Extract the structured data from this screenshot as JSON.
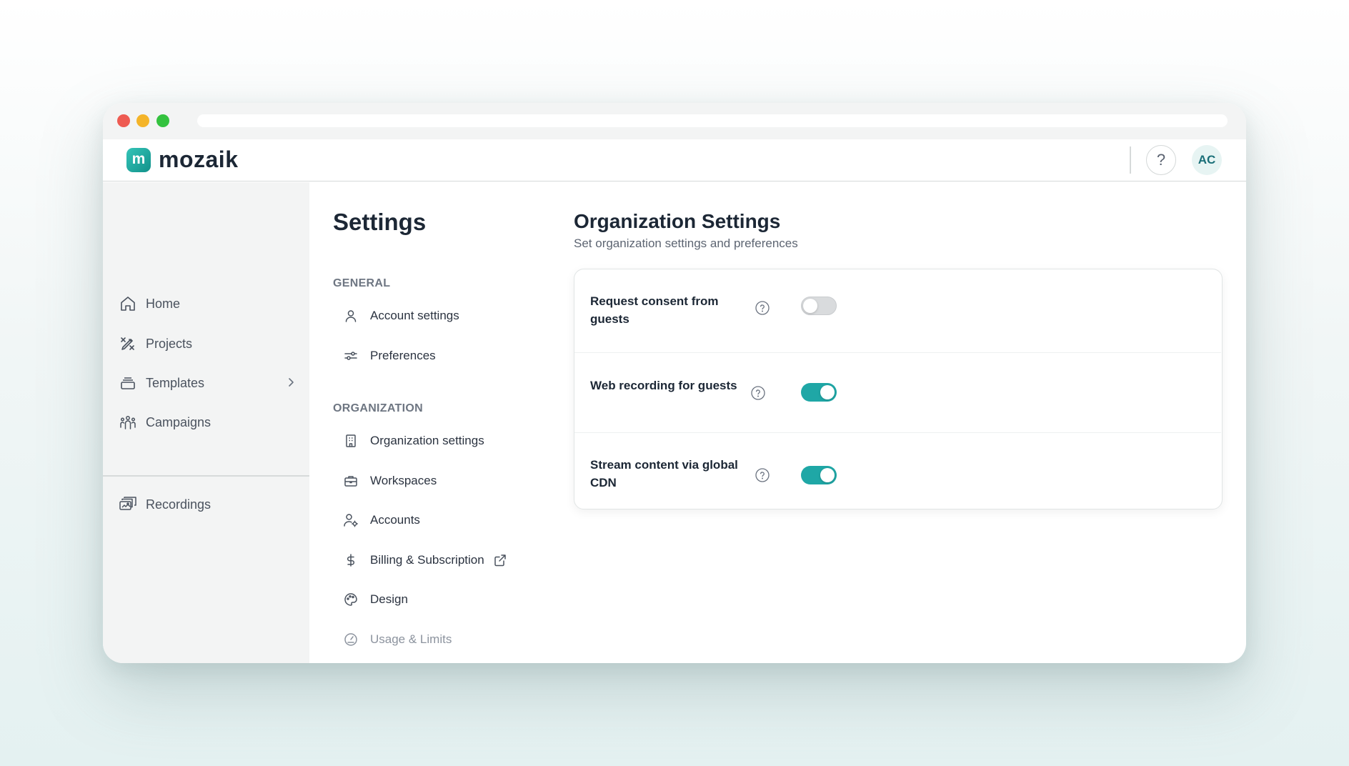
{
  "app": {
    "brand": "mozaik",
    "brand_mark": "m",
    "accent_color": "#1fa7a6",
    "help_label": "?",
    "avatar_initials": "AC"
  },
  "sidebar": {
    "items": [
      {
        "label": "Home",
        "icon": "home-icon"
      },
      {
        "label": "Projects",
        "icon": "projects-icon"
      },
      {
        "label": "Templates",
        "icon": "templates-icon",
        "has_chevron": true
      },
      {
        "label": "Campaigns",
        "icon": "campaigns-icon"
      },
      {
        "label": "Recordings",
        "icon": "recordings-icon"
      }
    ]
  },
  "settings_menu": {
    "title": "Settings",
    "general": {
      "label": "GENERAL",
      "items": [
        {
          "label": "Account settings",
          "icon": "user-icon"
        },
        {
          "label": "Preferences",
          "icon": "sliders-icon"
        }
      ]
    },
    "organization": {
      "label": "ORGANIZATION",
      "items": [
        {
          "label": "Organization settings",
          "icon": "building-icon"
        },
        {
          "label": "Workspaces",
          "icon": "briefcase-icon"
        },
        {
          "label": "Accounts",
          "icon": "user-gear-icon"
        },
        {
          "label": "Billing & Subscription",
          "icon": "dollar-icon",
          "external": true
        },
        {
          "label": "Design",
          "icon": "palette-icon"
        },
        {
          "label": "Usage & Limits",
          "icon": "gauge-icon"
        }
      ]
    }
  },
  "main": {
    "title": "Organization Settings",
    "subtitle": "Set organization settings and preferences",
    "settings": [
      {
        "label": "Request consent from guests",
        "enabled": false
      },
      {
        "label": "Web recording for guests",
        "enabled": true
      },
      {
        "label": "Stream content via global CDN",
        "enabled": true
      }
    ]
  }
}
